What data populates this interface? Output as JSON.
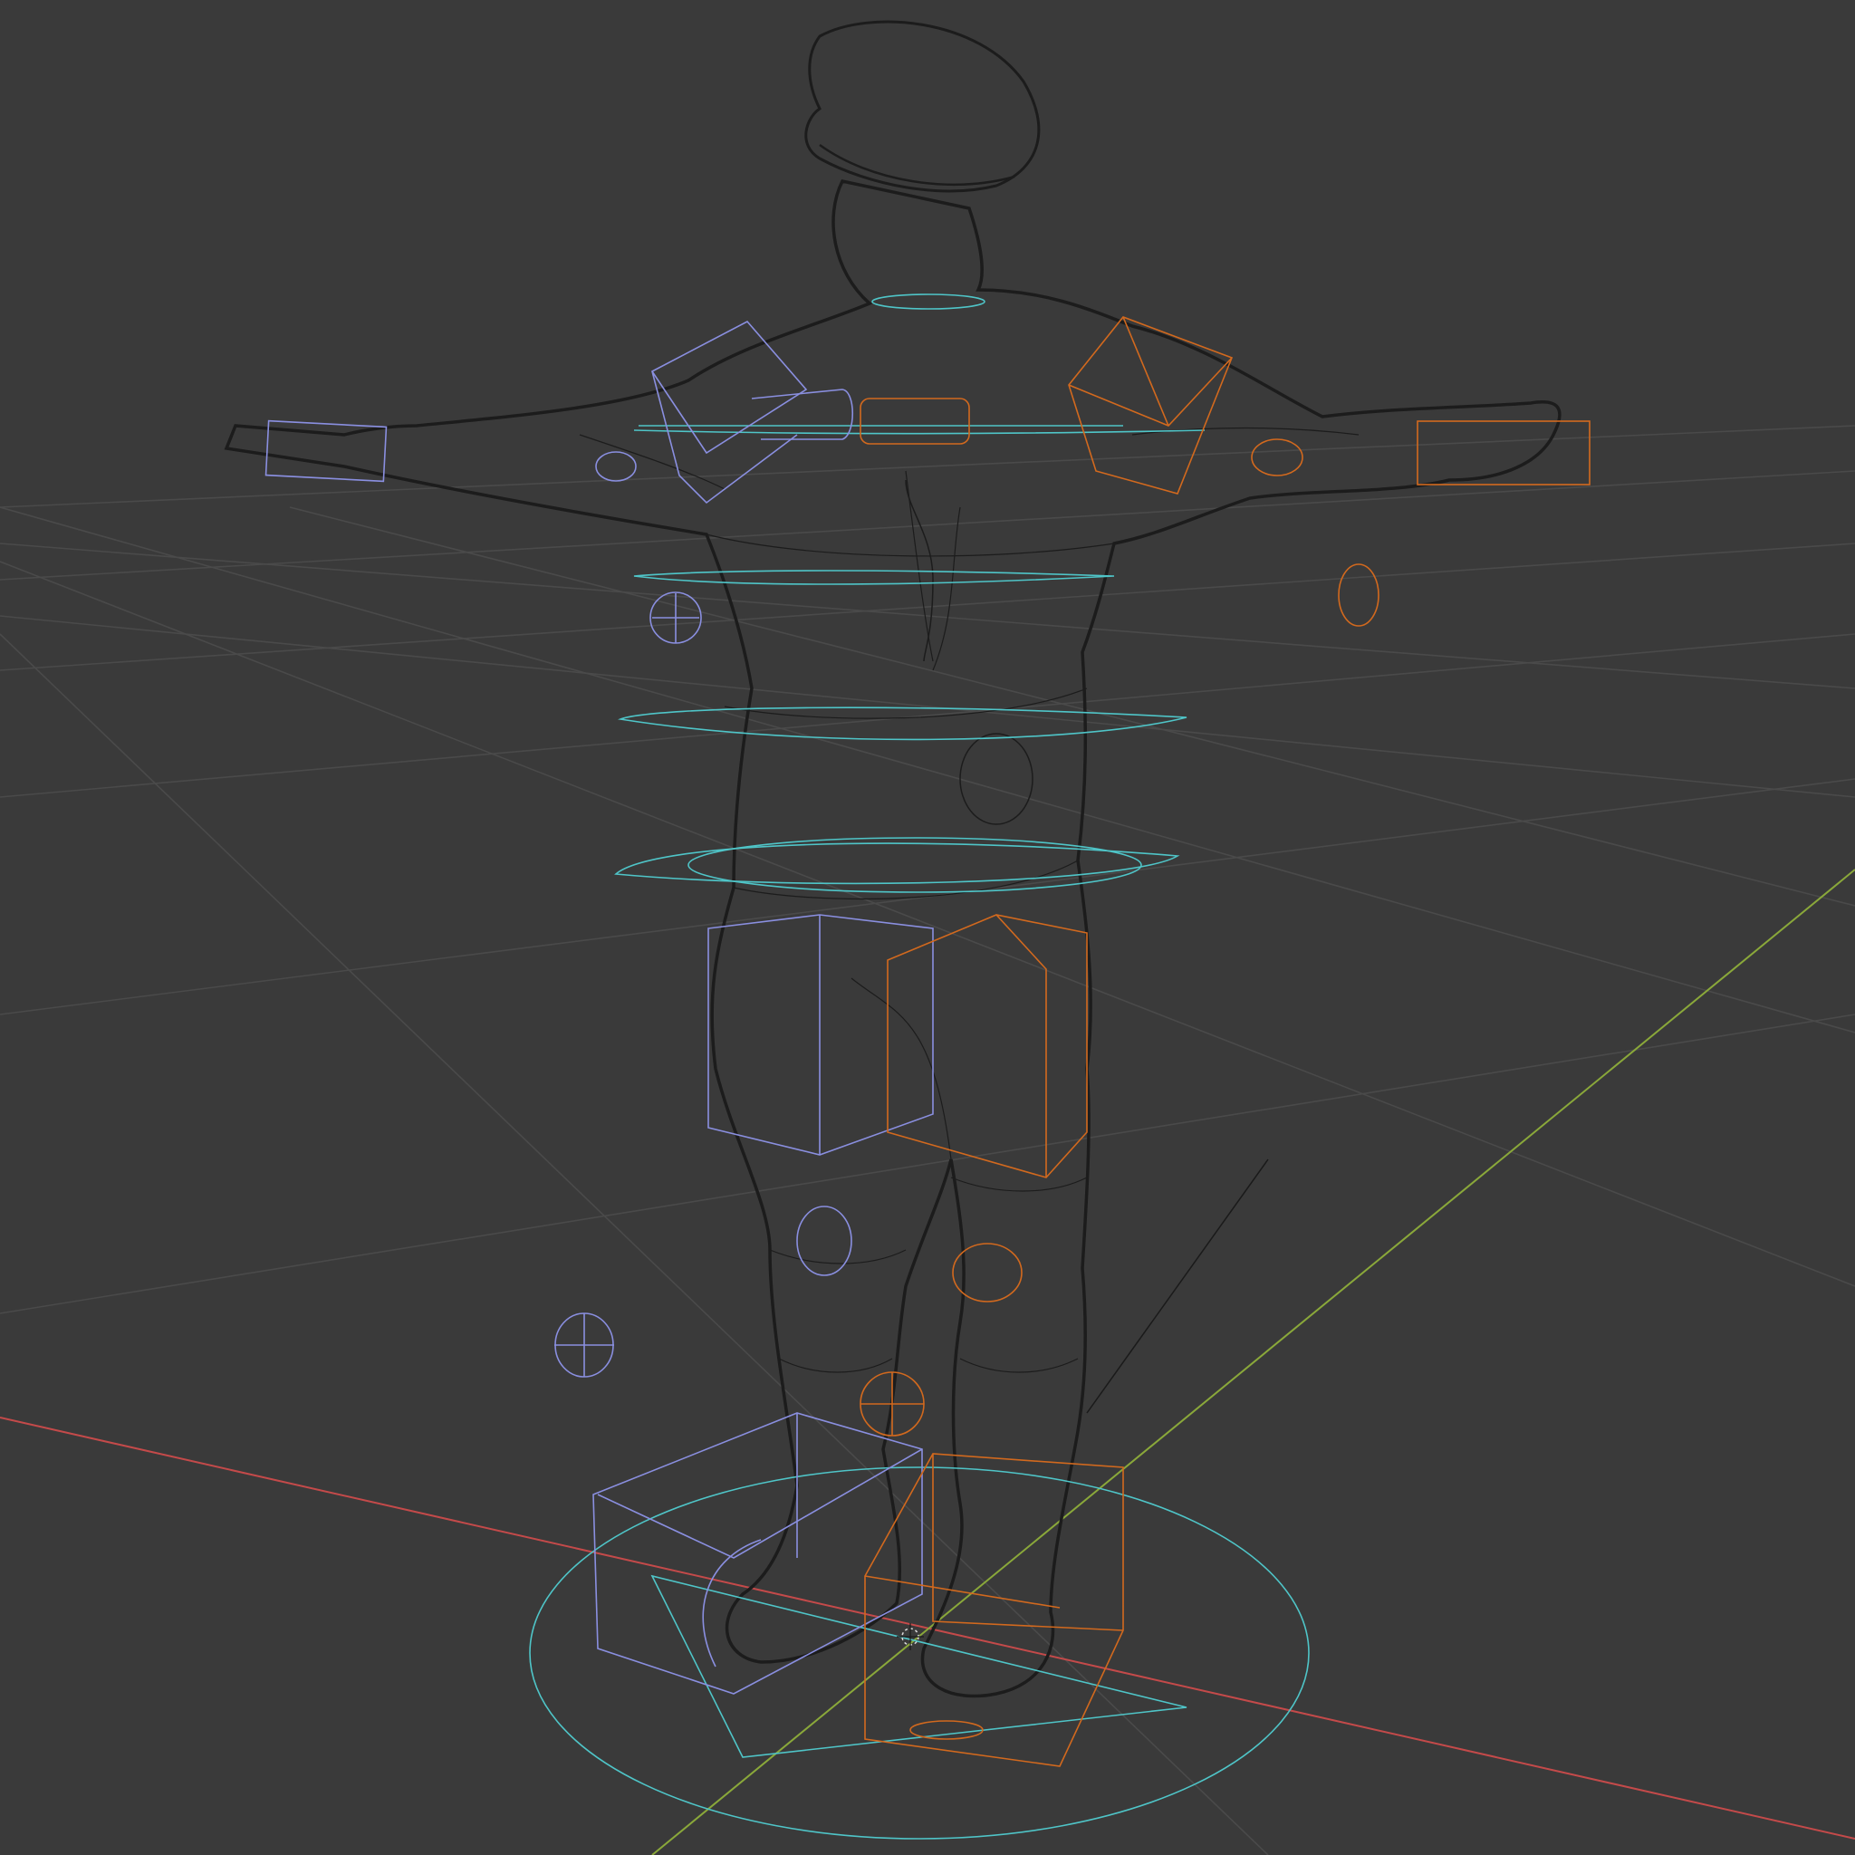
{
  "viewport": {
    "background_color": "#3a3a3a",
    "grid_color": "#4a4a4a",
    "x_axis_color": "#c44a4a",
    "y_axis_color": "#8aa83a",
    "mesh_color": "#1c1c1c"
  },
  "scene": {
    "object": "character-wireframe-mesh",
    "rig_controls": {
      "center_color": "#4fc5c8",
      "left_side_color": "#8a8fe0",
      "right_side_color": "#d2691e"
    }
  }
}
